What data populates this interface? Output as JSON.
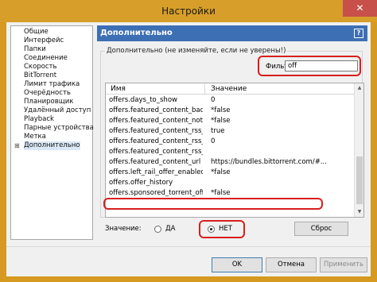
{
  "window": {
    "title": "Настройки",
    "close_glyph": "✕"
  },
  "sidebar": {
    "items": [
      {
        "label": "Общие"
      },
      {
        "label": "Интерфейс"
      },
      {
        "label": "Папки"
      },
      {
        "label": "Соединение"
      },
      {
        "label": "Скорость"
      },
      {
        "label": "BitTorrent"
      },
      {
        "label": "Лимит трафика"
      },
      {
        "label": "Очерёдность"
      },
      {
        "label": "Планировщик"
      },
      {
        "label": "Удалённый доступ"
      },
      {
        "label": "Playback"
      },
      {
        "label": "Парные устройства"
      },
      {
        "label": "Метка"
      },
      {
        "label": "Дополнительно"
      }
    ],
    "selected_index": 13,
    "expander_glyph": "⊞"
  },
  "panel": {
    "title": "Дополнительно",
    "help_glyph": "?",
    "group_label": "Дополнительно (не изменяйте, если не уверены!)",
    "filter_label": "Фильт",
    "filter_value": "off"
  },
  "grid": {
    "columns": {
      "name": "Имя",
      "value": "Значение"
    },
    "rows": [
      {
        "name": "offers.days_to_show",
        "value": "0"
      },
      {
        "name": "offers.featured_content_badge_enabled",
        "value": "*false"
      },
      {
        "name": "offers.featured_content_notifications_enabled",
        "value": "*false"
      },
      {
        "name": "offers.featured_content_rss_enabled",
        "value": "true"
      },
      {
        "name": "offers.featured_content_rss_update_interval",
        "value": "0"
      },
      {
        "name": "offers.featured_content_rss_url",
        "value": ""
      },
      {
        "name": "offers.featured_content_url",
        "value": "https://bundles.bittorrent.com/#..."
      },
      {
        "name": "offers.left_rail_offer_enabled",
        "value": "*false"
      },
      {
        "name": "offers.offer_history",
        "value": ""
      },
      {
        "name": "offers.sponsored_torrent_offer_enabled",
        "value": "*false"
      }
    ],
    "arrow_up": "▲",
    "arrow_down": "▼"
  },
  "value_editor": {
    "label": "Значение:",
    "option_yes": "ДА",
    "option_no": "НЕТ",
    "selected": "no",
    "reset_label": "Сброс"
  },
  "footer": {
    "ok_label": "OK",
    "cancel_label": "Отмена",
    "apply_label": "Применить"
  },
  "highlight_color": "#d81e1e",
  "accent_color": "#3d6fb4",
  "title_bar_color": "#d79f2a"
}
